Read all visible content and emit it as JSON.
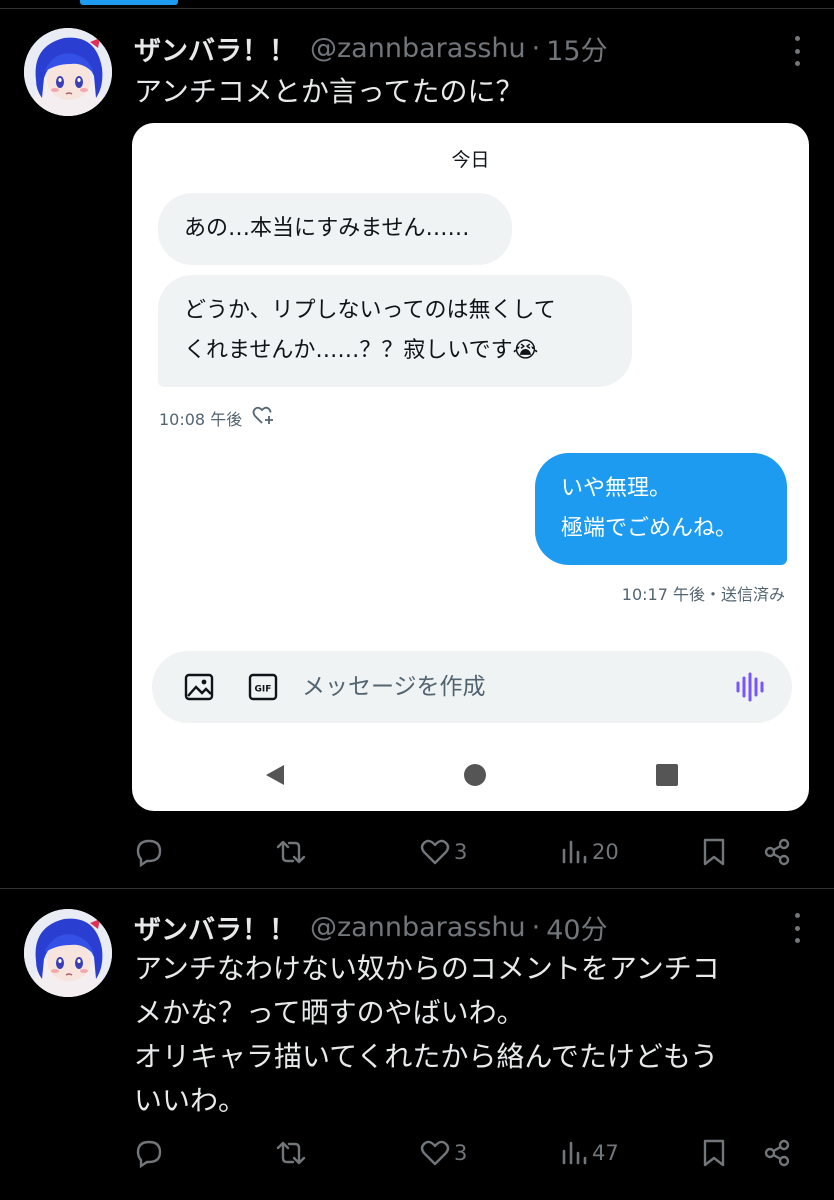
{
  "tweets": [
    {
      "name": "ザンバラ！！",
      "handle": "@zannbarasshu",
      "separator": "·",
      "time": "15分",
      "text_lines": [
        "アンチコメとか言ってたのに？"
      ],
      "embedded_dm": {
        "day_label": "今日",
        "incoming": [
          {
            "lines": [
              "あの…本当にすみません……"
            ]
          },
          {
            "lines": [
              "どうか、リプしないってのは無くして",
              "くれませんか……？？寂しいです😭"
            ]
          }
        ],
        "incoming_meta": "10:08 午後",
        "outgoing_lines": [
          "いや無理。",
          "極端でごめんね。"
        ],
        "outgoing_meta": "10:17 午後・送信済み",
        "composer_placeholder": "メッセージを作成",
        "gif_label": "GIF"
      },
      "actions": {
        "reply": "",
        "retweet": "",
        "likes": "3",
        "views": "20"
      }
    },
    {
      "name": "ザンバラ！！",
      "handle": "@zannbarasshu",
      "separator": "·",
      "time": "40分",
      "text_lines": [
        "アンチなわけない奴からのコメントをアンチコ",
        "メかな？って晒すのやばいわ。",
        "オリキャラ描いてくれたから絡んでたけどもう",
        "いいわ。"
      ],
      "actions": {
        "reply": "",
        "retweet": "",
        "likes": "3",
        "views": "47"
      }
    }
  ],
  "colors": {
    "background": "#000000",
    "accent": "#1d9bf0",
    "text_primary": "#e7e9ea",
    "text_secondary": "#71767b",
    "voice_icon": "#7856ff"
  },
  "icons": [
    "more-icon",
    "reply-icon",
    "retweet-icon",
    "like-icon",
    "views-icon",
    "bookmark-icon",
    "share-icon",
    "image-icon",
    "gif-icon",
    "voice-icon",
    "react-icon",
    "nav-back-icon",
    "nav-home-icon",
    "nav-recent-icon"
  ]
}
